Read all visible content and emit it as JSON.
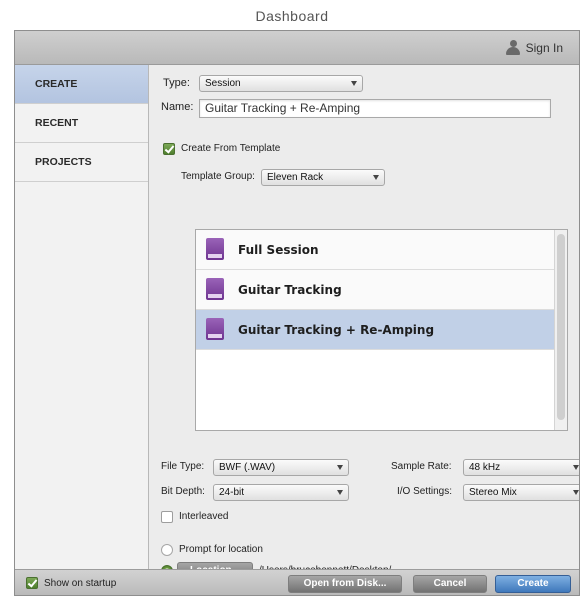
{
  "window": {
    "title": "Dashboard"
  },
  "header": {
    "sign_in_label": "Sign In"
  },
  "sidebar": {
    "items": [
      {
        "label": "CREATE",
        "active": true
      },
      {
        "label": "RECENT",
        "active": false
      },
      {
        "label": "PROJECTS",
        "active": false
      }
    ]
  },
  "create": {
    "type_label": "Type:",
    "type_value": "Session",
    "name_label": "Name:",
    "name_value": "Guitar Tracking + Re-Amping",
    "create_from_template_label": "Create From Template",
    "create_from_template_checked": true,
    "template_group_label": "Template Group:",
    "template_group_value": "Eleven Rack",
    "templates": [
      {
        "name": "Full Session",
        "selected": false
      },
      {
        "name": "Guitar Tracking",
        "selected": false
      },
      {
        "name": "Guitar Tracking + Re-Amping",
        "selected": true
      }
    ],
    "file_type_label": "File Type:",
    "file_type_value": "BWF (.WAV)",
    "sample_rate_label": "Sample Rate:",
    "sample_rate_value": "48 kHz",
    "bit_depth_label": "Bit Depth:",
    "bit_depth_value": "24-bit",
    "io_settings_label": "I/O Settings:",
    "io_settings_value": "Stereo Mix",
    "interleaved_label": "Interleaved",
    "interleaved_checked": false,
    "prompt_location_label": "Prompt for location",
    "location_button_label": "Location...",
    "location_path": "/Users/brucebennett/Desktop/"
  },
  "footer": {
    "show_on_startup_label": "Show on startup",
    "show_on_startup_checked": true,
    "open_from_disk_label": "Open from Disk...",
    "cancel_label": "Cancel",
    "create_label": "Create"
  },
  "colors": {
    "accent": "#3f78bb",
    "selection": "#c1d0e7",
    "check_green": "#4f7f2e",
    "template_icon": "#7a3f9e"
  }
}
